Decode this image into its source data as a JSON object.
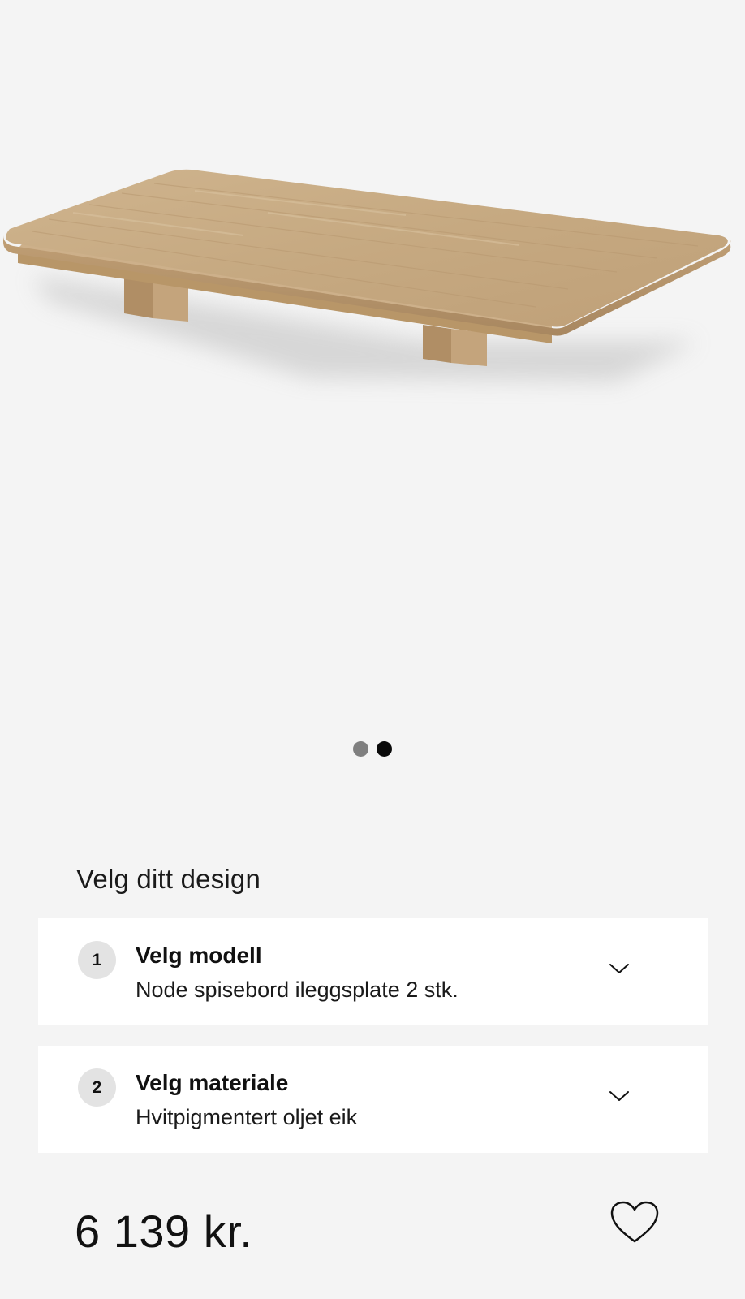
{
  "product": {
    "image_alt": "Node spisebord ileggsplate",
    "carousel": {
      "total": 2,
      "active_index": 1
    }
  },
  "configurator": {
    "title": "Velg ditt design",
    "options": [
      {
        "step": "1",
        "title": "Velg modell",
        "value": "Node spisebord ileggsplate 2 stk."
      },
      {
        "step": "2",
        "title": "Velg materiale",
        "value": "Hvitpigmentert oljet eik"
      }
    ]
  },
  "price": "6 139 kr.",
  "icons": {
    "expand": "chevron-down-icon",
    "wishlist": "heart-icon"
  },
  "colors": {
    "background": "#f4f4f4",
    "card": "#ffffff",
    "badge": "#e3e3e3",
    "wood": "#c9ab84"
  }
}
